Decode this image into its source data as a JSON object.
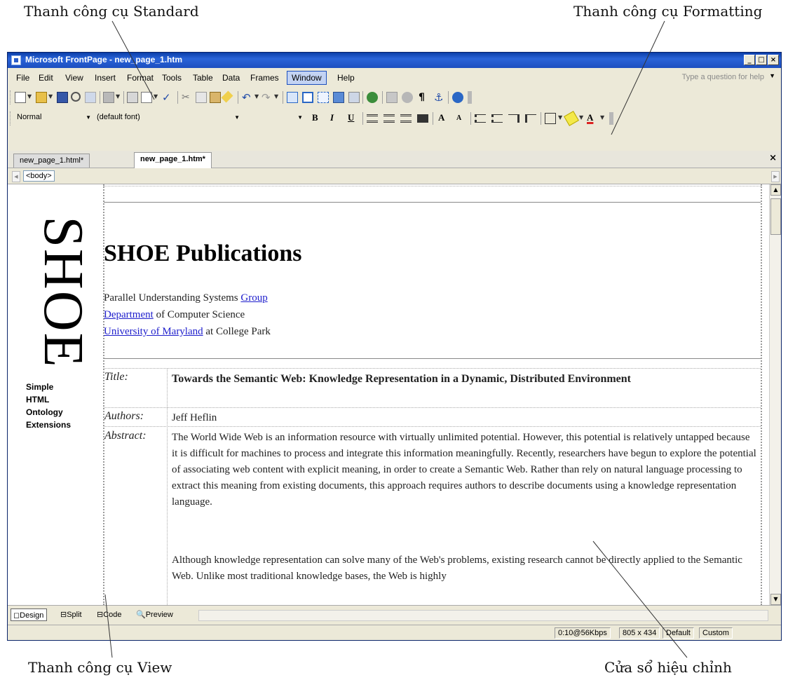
{
  "callouts": {
    "standard": "Thanh công cụ Standard",
    "formatting": "Thanh công cụ Formatting",
    "view": "Thanh công cụ View",
    "editor": "Cửa sổ hiệu chỉnh"
  },
  "window": {
    "title": "Microsoft FrontPage - new_page_1.htm",
    "controls": [
      "_",
      "□",
      "×"
    ]
  },
  "menu": {
    "items": [
      "File",
      "Edit",
      "View",
      "Insert",
      "Format",
      "Tools",
      "Table",
      "Data",
      "Frames",
      "Window",
      "Help"
    ],
    "active": "Window",
    "help_placeholder": "Type a question for help"
  },
  "formatting": {
    "style": "Normal",
    "font": "(default font)",
    "bold": "B",
    "italic": "I",
    "underline": "U",
    "grow_font": "A",
    "shrink_font": "A",
    "font_color": "A"
  },
  "tabs": {
    "items": [
      "new_page_1.html*",
      "new_page_1.htm*"
    ],
    "active_index": 1,
    "close": "×"
  },
  "tag_selector": "<body>",
  "page": {
    "logo_text": "SHOE",
    "logo_words": [
      "Simple",
      "HTML",
      "Ontology",
      "Extensions"
    ],
    "heading": "SHOE Publications",
    "affiliation": [
      {
        "before": "Parallel Understanding Systems ",
        "link": "Group",
        "after": ""
      },
      {
        "before": "",
        "link": "Department",
        "after": " of Computer Science"
      },
      {
        "before": "",
        "link": "University of Maryland",
        "after": " at College Park"
      }
    ],
    "title_label": "Title:",
    "title_value": "Towards the Semantic Web: Knowledge Representation in a Dynamic, Distributed Environment",
    "authors_label": "Authors:",
    "authors_value": "Jeff Heflin",
    "abstract_label": "Abstract:",
    "abstract_p1": "The World Wide Web is an information resource with virtually unlimited potential. However, this potential is relatively untapped because it is difficult for machines to process and integrate this information meaningfully. Recently, researchers have begun to explore the potential of associating web content with explicit meaning, in order to create a Semantic Web. Rather than rely on natural language processing to extract this meaning from existing documents, this approach requires authors to describe documents using a knowledge representation language.",
    "abstract_p2": "Although knowledge representation can solve many of the Web's problems, existing research cannot be directly applied to the Semantic Web. Unlike most traditional knowledge bases, the Web is highly"
  },
  "view_tabs": [
    "Design",
    "Split",
    "Code",
    "Preview"
  ],
  "view_active": "Design",
  "status": {
    "download": "0:10@56Kbps",
    "size": "805 x 434",
    "mode1": "Default",
    "mode2": "Custom"
  },
  "colors": {
    "titlebar": "#0b3ea8",
    "link": "#1e1ecc",
    "chrome": "#ece9d8"
  }
}
